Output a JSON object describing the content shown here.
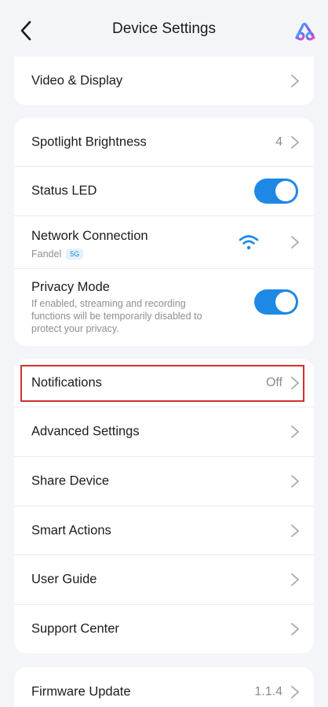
{
  "header": {
    "title": "Device Settings"
  },
  "sections": {
    "video_display": {
      "label": "Video & Display"
    },
    "spotlight": {
      "label": "Spotlight Brightness",
      "value": "4"
    },
    "status_led": {
      "label": "Status LED",
      "enabled": true
    },
    "network": {
      "label": "Network Connection",
      "ssid": "Fandel",
      "band": "5G"
    },
    "privacy": {
      "label": "Privacy Mode",
      "description_line1": "If enabled, streaming and recording",
      "description_line2": "functions will be temporarily disabled to",
      "description_line3": "protect your privacy.",
      "enabled": true
    },
    "notifications": {
      "label": "Notifications",
      "value": "Off"
    },
    "advanced": {
      "label": "Advanced Settings"
    },
    "share": {
      "label": "Share Device"
    },
    "smart_actions": {
      "label": "Smart Actions"
    },
    "user_guide": {
      "label": "User Guide"
    },
    "support": {
      "label": "Support Center"
    },
    "firmware": {
      "label": "Firmware Update",
      "value": "1.1.4"
    }
  },
  "colors": {
    "accent": "#1e88e5",
    "highlight": "#d32f2f",
    "background": "#f4f5f9"
  }
}
